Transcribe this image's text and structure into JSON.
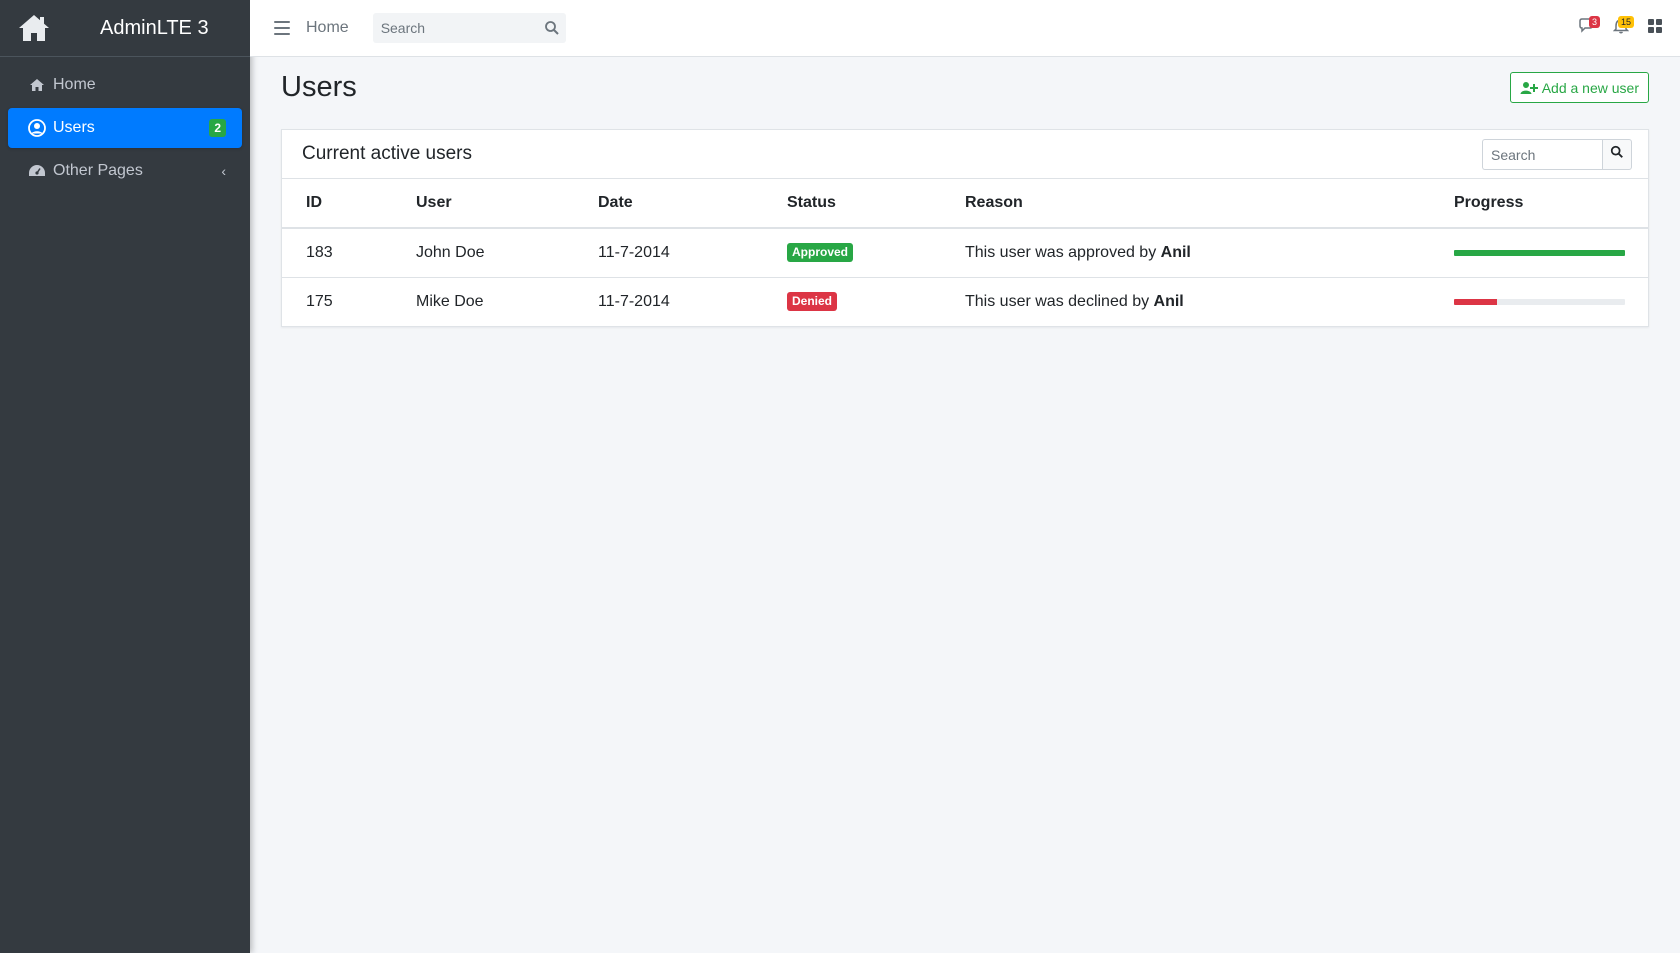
{
  "brand": {
    "name": "AdminLTE 3"
  },
  "sidebar": {
    "items": [
      {
        "label": "Home",
        "icon": "home-icon"
      },
      {
        "label": "Users",
        "icon": "user-circle-icon",
        "badge": "2",
        "active": true
      },
      {
        "label": "Other Pages",
        "icon": "dashboard-icon",
        "chevron": "‹"
      }
    ]
  },
  "topbar": {
    "home_label": "Home",
    "search_placeholder": "Search",
    "notifications": {
      "messages_count": "3",
      "alerts_count": "15"
    }
  },
  "page": {
    "title": "Users",
    "add_button_label": "Add a new user"
  },
  "card": {
    "title": "Current active users",
    "search_placeholder": "Search",
    "columns": [
      "ID",
      "User",
      "Date",
      "Status",
      "Reason",
      "Progress"
    ],
    "rows": [
      {
        "id": "183",
        "user": "John Doe",
        "date": "11-7-2014",
        "status": "Approved",
        "status_color": "#28a745",
        "reason_prefix": "This user was approved by ",
        "reason_by": "Anil",
        "progress": 1.0,
        "progress_color": "#28a745"
      },
      {
        "id": "175",
        "user": "Mike Doe",
        "date": "11-7-2014",
        "status": "Denied",
        "status_color": "#dc3545",
        "reason_prefix": "This user was declined by ",
        "reason_by": "Anil",
        "progress": 0.25,
        "progress_color": "#dc3545"
      }
    ]
  },
  "colors": {
    "primary": "#007bff",
    "success": "#28a745",
    "danger": "#dc3545",
    "warning": "#ffc107",
    "sidebar_bg": "#343a40"
  }
}
